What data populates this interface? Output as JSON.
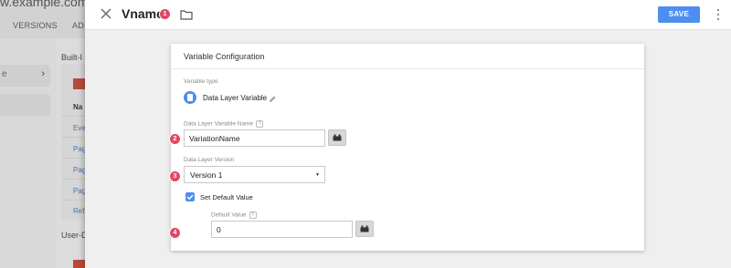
{
  "background": {
    "domain": "w.example.com",
    "tabs": [
      "VERSIONS",
      "ADM"
    ],
    "section_builtin": "Built-I",
    "section_user": "User-D",
    "left_glyph": "e",
    "table_header": "Na",
    "rows": [
      "Eve",
      "Pag",
      "Pag",
      "Pag",
      "Ref"
    ]
  },
  "header": {
    "title": "Vname",
    "save_label": "SAVE"
  },
  "markers": [
    "1",
    "2",
    "3",
    "4"
  ],
  "card": {
    "title": "Variable Configuration",
    "variable_type_label": "Variable type",
    "variable_type_value": "Data Layer Variable",
    "dl_name_label": "Data Layer Variable Name",
    "dl_name_value": "VariationName",
    "dl_version_label": "Data Layer Version",
    "dl_version_value": "Version 1",
    "default_checkbox_label": "Set Default Value",
    "default_checkbox_checked": true,
    "default_value_label": "Default Value",
    "default_value": "0",
    "help_glyph": "?"
  },
  "colors": {
    "accent": "#4d8ef0",
    "marker": "#e24764"
  }
}
